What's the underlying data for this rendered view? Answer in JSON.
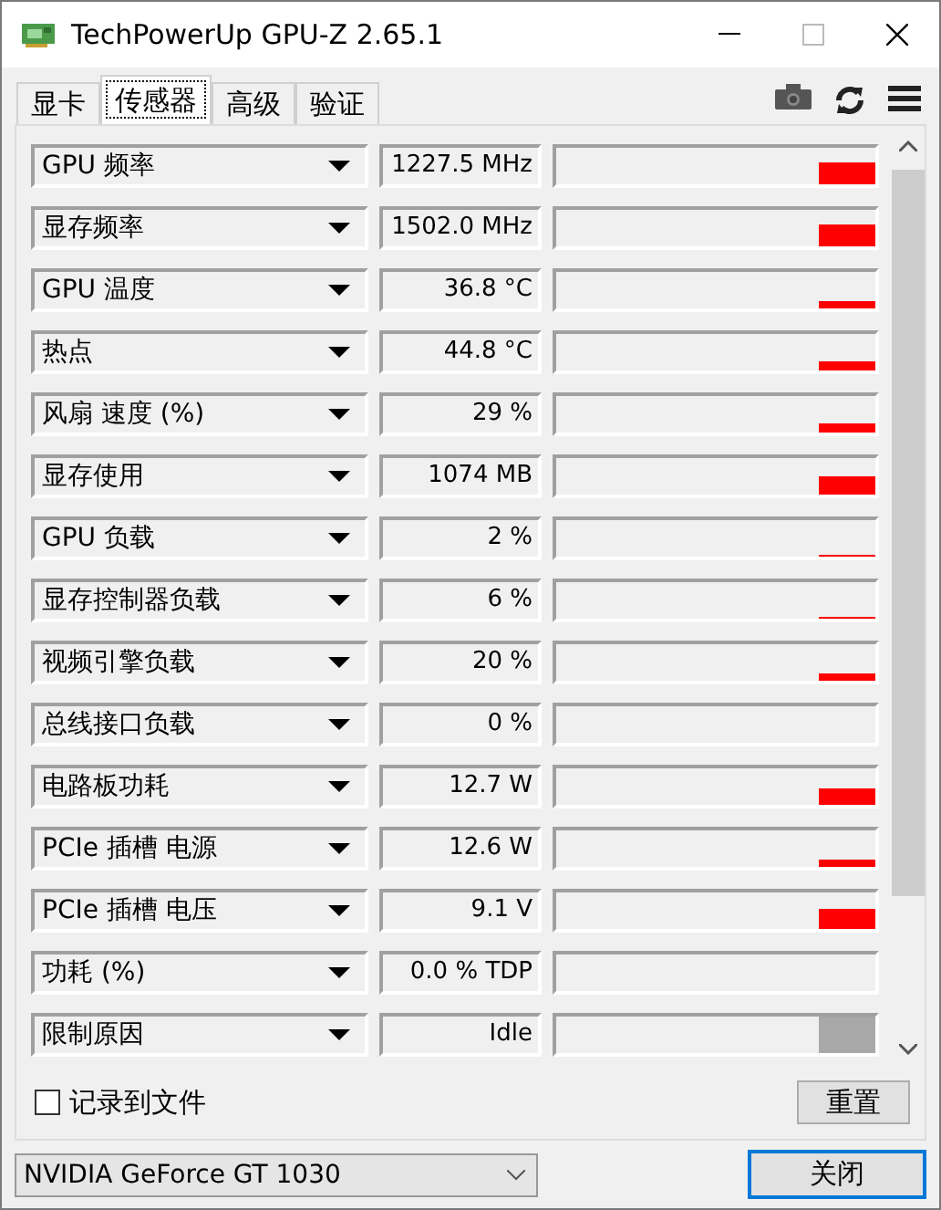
{
  "window": {
    "title": "TechPowerUp GPU-Z 2.65.1"
  },
  "tabs": [
    {
      "label": "显卡",
      "selected": false
    },
    {
      "label": "传感器",
      "selected": true
    },
    {
      "label": "高级",
      "selected": false
    },
    {
      "label": "验证",
      "selected": false
    }
  ],
  "sensors": [
    {
      "name": "GPU 频率",
      "value": "1227.5 MHz"
    },
    {
      "name": "显存频率",
      "value": "1502.0 MHz"
    },
    {
      "name": "GPU 温度",
      "value": "36.8 °C"
    },
    {
      "name": "热点",
      "value": "44.8 °C"
    },
    {
      "name": "风扇 速度 (%)",
      "value": "29 %"
    },
    {
      "name": "显存使用",
      "value": "1074 MB"
    },
    {
      "name": "GPU 负载",
      "value": "2 %"
    },
    {
      "name": "显存控制器负载",
      "value": "6 %"
    },
    {
      "name": "视频引擎负载",
      "value": "20 %"
    },
    {
      "name": "总线接口负载",
      "value": "0 %"
    },
    {
      "name": "电路板功耗",
      "value": "12.7 W"
    },
    {
      "name": "PCIe 插槽 电源",
      "value": "12.6 W"
    },
    {
      "name": "PCIe 插槽 电压",
      "value": "9.1 V"
    },
    {
      "name": "功耗 (%)",
      "value": "0.0 % TDP"
    },
    {
      "name": "限制原因",
      "value": "Idle"
    }
  ],
  "log_to_file": {
    "label": "记录到文件",
    "checked": false
  },
  "reset_button": "重置",
  "gpu_select": {
    "value": "NVIDIA GeForce GT 1030"
  },
  "close_button": "关闭"
}
